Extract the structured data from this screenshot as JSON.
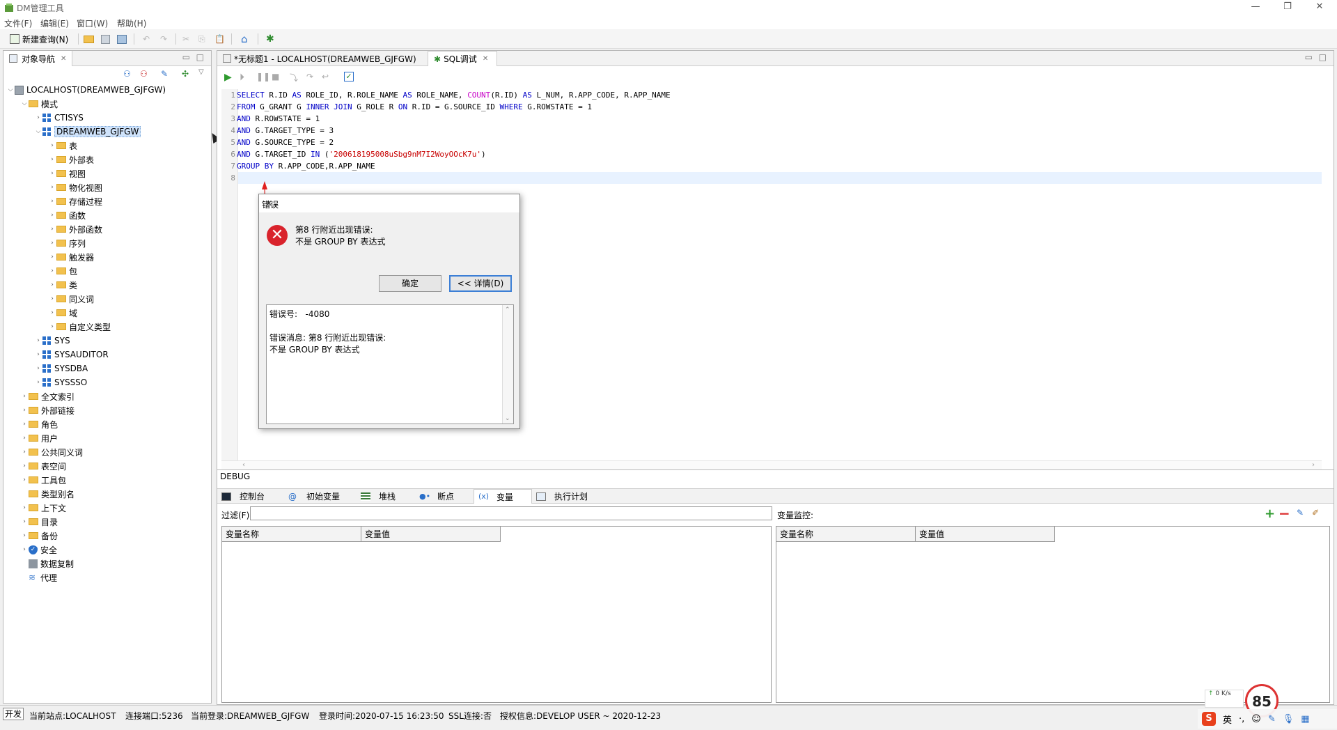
{
  "window": {
    "title": "DM管理工具"
  },
  "menu": [
    "文件(F)",
    "编辑(E)",
    "窗口(W)",
    "帮助(H)"
  ],
  "toolbar": {
    "new_query": "新建查询(N)"
  },
  "nav": {
    "tab_label": "对象导航",
    "server": "LOCALHOST(DREAMWEB_GJFGW)",
    "schema_folder": "模式",
    "schemas": [
      "CTISYS",
      "DREAMWEB_GJFGW",
      "SYS",
      "SYSAUDITOR",
      "SYSDBA",
      "SYSSSO"
    ],
    "schema_children": [
      "表",
      "外部表",
      "视图",
      "物化视图",
      "存储过程",
      "函数",
      "外部函数",
      "序列",
      "触发器",
      "包",
      "类",
      "同义词",
      "域",
      "自定义类型"
    ],
    "top_folders": [
      "全文索引",
      "外部链接",
      "角色",
      "用户",
      "公共同义词",
      "表空间",
      "工具包",
      "类型别名",
      "上下文",
      "目录",
      "备份",
      "安全",
      "数据复制",
      "代理"
    ]
  },
  "editor": {
    "tabs": [
      "*无标题1 - LOCALHOST(DREAMWEB_GJFGW)",
      "SQL调试"
    ],
    "lines": [
      {
        "n": "1",
        "seg": [
          [
            "kw",
            "SELECT"
          ],
          [
            "t",
            " R.ID "
          ],
          [
            "kw",
            "AS"
          ],
          [
            "t",
            " ROLE_ID, R.ROLE_NAME "
          ],
          [
            "kw",
            "AS"
          ],
          [
            "t",
            " ROLE_NAME, "
          ],
          [
            "fn",
            "COUNT"
          ],
          [
            "t",
            "(R.ID) "
          ],
          [
            "kw",
            "AS"
          ],
          [
            "t",
            " L_NUM, R.APP_CODE, R.APP_NAME"
          ]
        ]
      },
      {
        "n": "2",
        "seg": [
          [
            "kw",
            "FROM"
          ],
          [
            "t",
            " G_GRANT G "
          ],
          [
            "kw",
            "INNER JOIN"
          ],
          [
            "t",
            " G_ROLE R "
          ],
          [
            "kw",
            "ON"
          ],
          [
            "t",
            " R.ID = G.SOURCE_ID "
          ],
          [
            "kw",
            "WHERE"
          ],
          [
            "t",
            " G.ROWSTATE = 1"
          ]
        ]
      },
      {
        "n": "3",
        "seg": [
          [
            "kw",
            "AND"
          ],
          [
            "t",
            " R.ROWSTATE = 1"
          ]
        ]
      },
      {
        "n": "4",
        "seg": [
          [
            "kw",
            "AND"
          ],
          [
            "t",
            " G.TARGET_TYPE = 3"
          ]
        ]
      },
      {
        "n": "5",
        "seg": [
          [
            "kw",
            "AND"
          ],
          [
            "t",
            " G.SOURCE_TYPE = 2"
          ]
        ]
      },
      {
        "n": "6",
        "seg": [
          [
            "kw",
            "AND"
          ],
          [
            "t",
            " G.TARGET_ID "
          ],
          [
            "kw",
            "IN"
          ],
          [
            "t",
            " ("
          ],
          [
            "str",
            "'200618195008uSbg9nM7I2WoyOOcK7u'"
          ],
          [
            "t",
            ")"
          ]
        ]
      },
      {
        "n": "7",
        "seg": [
          [
            "kw",
            "GROUP BY"
          ],
          [
            "t",
            " R.APP_CODE,R.APP_NAME"
          ]
        ]
      },
      {
        "n": "8",
        "seg": []
      }
    ]
  },
  "debug": {
    "label": "DEBUG",
    "tabs": [
      "控制台",
      "初始变量",
      "堆栈",
      "断点",
      "变量",
      "执行计划"
    ],
    "filter_label": "过滤(F):",
    "monitor_label": "变量监控:",
    "col_name": "变量名称",
    "col_value": "变量值"
  },
  "dialog": {
    "title": "错误",
    "line1": "第8 行附近出现错误:",
    "line2": "不是 GROUP BY 表达式",
    "ok": "确定",
    "details": "<< 详情(D)",
    "code_label": "错误号:",
    "code_value": "-4080",
    "msg_label": "错误消息: 第8 行附近出现错误:",
    "msg_line2": "不是 GROUP BY 表达式"
  },
  "status": {
    "mode": "开发",
    "site": "当前站点:LOCALHOST",
    "port": "连接端口:5236",
    "login": "当前登录:DREAMWEB_GJFGW",
    "login_time": "登录时间:2020-07-15 16:23:50",
    "ssl": "SSL连接:否",
    "license": "授权信息:DEVELOP USER ~ 2020-12-23"
  },
  "tray": {
    "speed_up": "0 K/s",
    "gauge": "85",
    "ime": "英"
  },
  "colors": {
    "keyword": "#0000c8",
    "function": "#c800c8",
    "string": "#c80000",
    "error": "#d9232c"
  }
}
